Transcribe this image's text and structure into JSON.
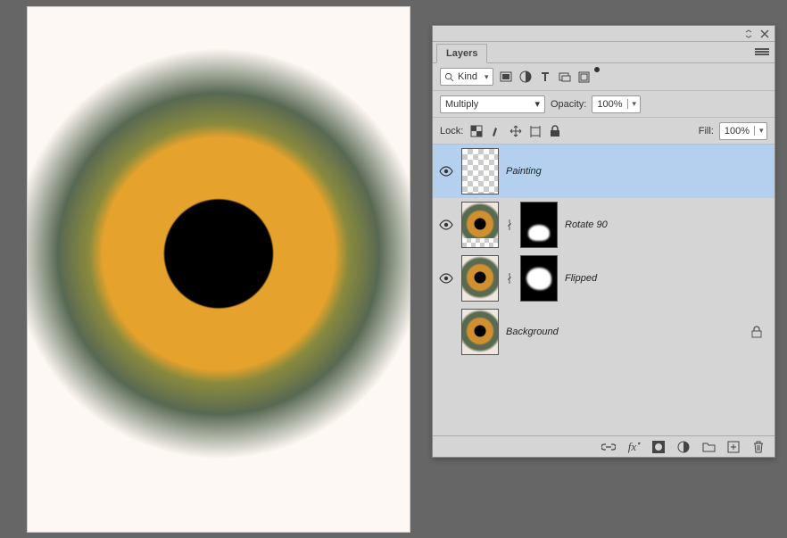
{
  "panel": {
    "tab_label": "Layers",
    "filter": {
      "kind_label": "Kind"
    },
    "blend": {
      "mode": "Multiply",
      "opacity_label": "Opacity:",
      "opacity_value": "100%"
    },
    "lock": {
      "label": "Lock:",
      "fill_label": "Fill:",
      "fill_value": "100%"
    },
    "layers": [
      {
        "name": "Painting",
        "visible": true,
        "selected": true,
        "thumb": "checker",
        "mask": null,
        "locked": false
      },
      {
        "name": "Rotate 90",
        "visible": true,
        "selected": false,
        "thumb": "eye-checker",
        "mask": "lower",
        "locked": false
      },
      {
        "name": "Flipped",
        "visible": true,
        "selected": false,
        "thumb": "eye",
        "mask": "mid",
        "locked": false
      },
      {
        "name": "Background",
        "visible": false,
        "selected": false,
        "thumb": "eye",
        "mask": null,
        "locked": true
      }
    ]
  }
}
